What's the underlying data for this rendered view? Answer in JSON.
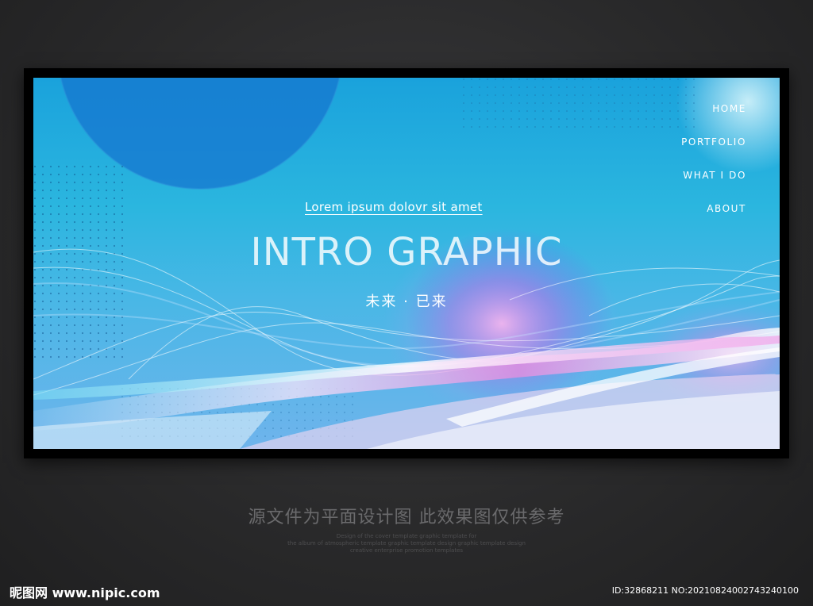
{
  "banner": {
    "link_text": "Lorem ipsum dolovr sit amet",
    "headline": "INTRO GRAPHIC",
    "tagline": "未来 · 已来"
  },
  "nav": {
    "items": [
      {
        "label": "HOME"
      },
      {
        "label": "PORTFOLIO"
      },
      {
        "label": "WHAT I DO"
      },
      {
        "label": "ABOUT"
      }
    ]
  },
  "caption": {
    "main": "源文件为平面设计图 此效果图仅供参考",
    "fine_print": [
      "Design of the cover template graphic template for",
      "the album of atmospheric template graphic template design graphic template design",
      "creative enterprise promotion templates"
    ]
  },
  "watermark": {
    "left": "昵图网 www.nipic.com",
    "right": "ID:32868211 NO:20210824002743240100"
  },
  "colors": {
    "background": "#2a2a2b",
    "banner_top": "#1aa2dc",
    "banner_accent_pink": "#e9a9e8",
    "banner_accent_blue": "#4f7ff0"
  }
}
